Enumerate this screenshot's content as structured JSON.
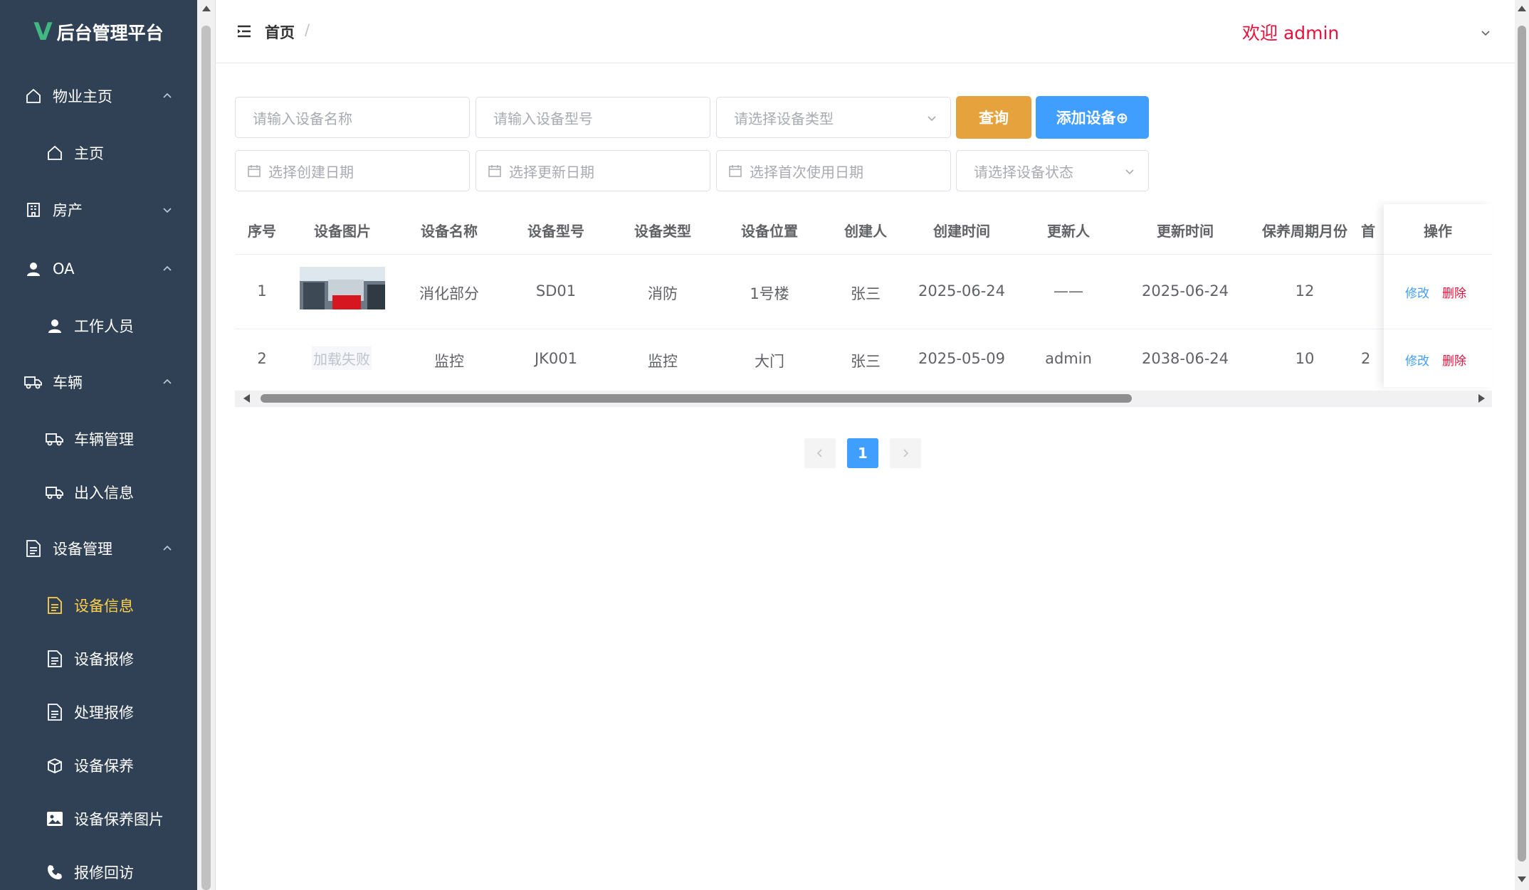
{
  "brand": {
    "logo": "V",
    "title": "后台管理平台"
  },
  "sidebar": {
    "items": [
      {
        "label": "物业主页",
        "icon": "home-icon",
        "level": 1,
        "expanded": true
      },
      {
        "label": "主页",
        "icon": "home-icon",
        "level": 2
      },
      {
        "label": "房产",
        "icon": "building-icon",
        "level": 1,
        "expanded": false
      },
      {
        "label": "OA",
        "icon": "user-icon",
        "level": 1,
        "expanded": true
      },
      {
        "label": "工作人员",
        "icon": "user-icon",
        "level": 2
      },
      {
        "label": "车辆",
        "icon": "truck-icon",
        "level": 1,
        "expanded": true
      },
      {
        "label": "车辆管理",
        "icon": "truck-icon",
        "level": 2
      },
      {
        "label": "出入信息",
        "icon": "truck-icon",
        "level": 2
      },
      {
        "label": "设备管理",
        "icon": "document-icon",
        "level": 1,
        "expanded": true
      },
      {
        "label": "设备信息",
        "icon": "document-icon",
        "level": 2,
        "active": true
      },
      {
        "label": "设备报修",
        "icon": "document-icon",
        "level": 2
      },
      {
        "label": "处理报修",
        "icon": "document-icon",
        "level": 2
      },
      {
        "label": "设备保养",
        "icon": "box-icon",
        "level": 2
      },
      {
        "label": "设备保养图片",
        "icon": "picture-icon",
        "level": 2
      },
      {
        "label": "报修回访",
        "icon": "phone-icon",
        "level": 2
      }
    ]
  },
  "header": {
    "breadcrumb_home": "首页",
    "breadcrumb_sep": "/",
    "welcome": "欢迎 admin"
  },
  "filters": {
    "device_name_placeholder": "请输入设备名称",
    "device_model_placeholder": "请输入设备型号",
    "device_type_placeholder": "请选择设备类型",
    "query_label": "查询",
    "add_label": "添加设备⊕",
    "create_date_placeholder": "选择创建日期",
    "update_date_placeholder": "选择更新日期",
    "first_use_date_placeholder": "选择首次使用日期",
    "device_status_placeholder": "请选择设备状态"
  },
  "table": {
    "columns": [
      "序号",
      "设备图片",
      "设备名称",
      "设备型号",
      "设备类型",
      "设备位置",
      "创建人",
      "创建时间",
      "更新人",
      "更新时间",
      "保养周期月份",
      "首",
      "操作"
    ],
    "rows": [
      {
        "index": "1",
        "image": "photo",
        "name": "消化部分",
        "model": "SD01",
        "type": "消防",
        "location": "1号楼",
        "creator": "张三",
        "created": "2025-06-24",
        "updater": "——",
        "updated": "2025-06-24",
        "cycle": "12",
        "first": "",
        "edit": "修改",
        "del": "删除"
      },
      {
        "index": "2",
        "image": "加载失败",
        "name": "监控",
        "model": "JK001",
        "type": "监控",
        "location": "大门",
        "creator": "张三",
        "created": "2025-05-09",
        "updater": "admin",
        "updated": "2038-06-24",
        "cycle": "10",
        "first": "2",
        "edit": "修改",
        "del": "删除"
      }
    ]
  },
  "pagination": {
    "current": "1"
  },
  "colors": {
    "sidebar_bg": "#304156",
    "active": "#ffd04b",
    "primary": "#409eff",
    "warning": "#e6a23c",
    "danger": "#e6113c"
  }
}
